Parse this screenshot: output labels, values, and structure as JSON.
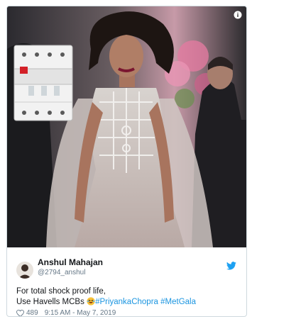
{
  "tweet": {
    "author_name": "Anshul Mahajan",
    "author_handle": "@2794_anshul",
    "text_line1": "For total shock proof life,",
    "text_line2_prefix": "Use Havells MCBs ",
    "hashtag1": "#PriyankaChopra",
    "hashtag2": "#MetGala",
    "likes": "489",
    "timestamp": "9:15 AM - May 7, 2019"
  },
  "icons": {
    "info": "info-icon",
    "bird": "twitter-bird-icon",
    "heart": "heart-icon",
    "emoji": "laughing-emoji"
  },
  "colors": {
    "link": "#1b95e0",
    "text": "#14171a",
    "muted": "#657786",
    "twitter_blue": "#1da1f2"
  }
}
